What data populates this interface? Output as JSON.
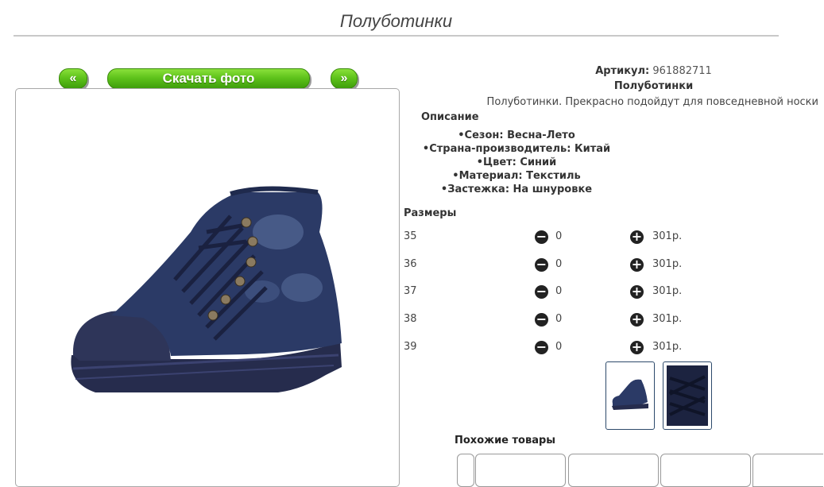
{
  "page": {
    "title": "Полуботинки"
  },
  "gallery": {
    "prev_label": "«",
    "download_label": "Скачать фото",
    "next_label": "»"
  },
  "product": {
    "article_label": "Артикул:",
    "article_value": "961882711",
    "name": "Полуботинки",
    "description": "Полуботинки. Прекрасно подойдут для повседневной носки",
    "description_title": "Описание",
    "features": [
      "Сезон: Весна-Лето",
      "Страна-производитель: Китай",
      "Цвет: Синий",
      "Материал: Текстиль",
      "Застежка: На шнуровке"
    ]
  },
  "sizes": {
    "title": "Размеры",
    "rows": [
      {
        "size": "35",
        "qty": "0",
        "price": "301р."
      },
      {
        "size": "36",
        "qty": "0",
        "price": "301р."
      },
      {
        "size": "37",
        "qty": "0",
        "price": "301р."
      },
      {
        "size": "38",
        "qty": "0",
        "price": "301р."
      },
      {
        "size": "39",
        "qty": "0",
        "price": "301р."
      }
    ]
  },
  "similar": {
    "title": "Похожие товары"
  },
  "icons": {
    "minus": "minus-circle-icon",
    "plus": "plus-circle-icon"
  },
  "colors": {
    "button_green": "#5fc31b",
    "shoe_denim": "#2b3a66"
  }
}
